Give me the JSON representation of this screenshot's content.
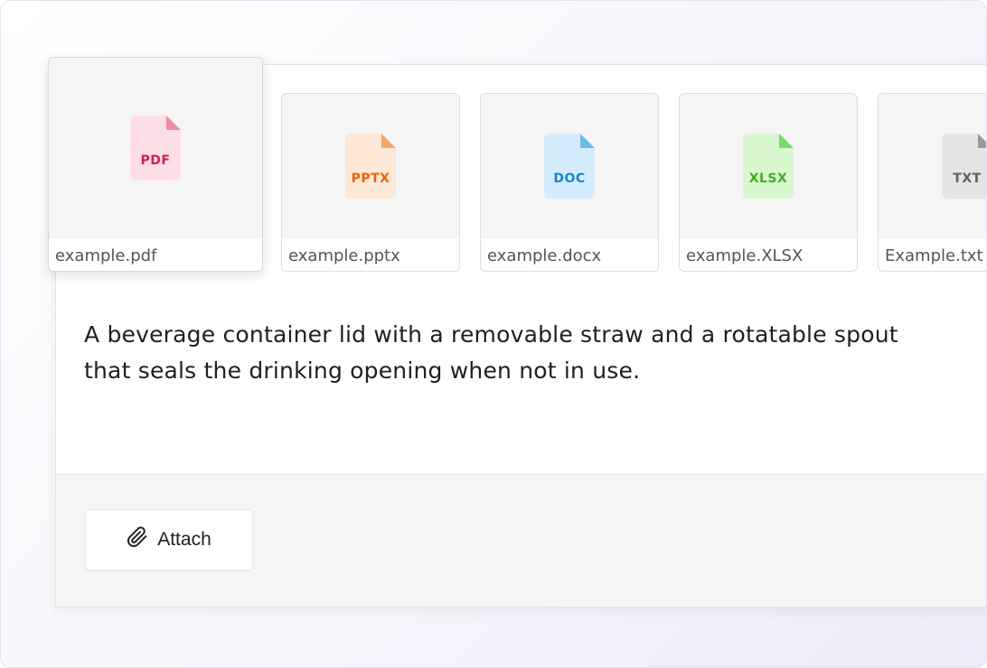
{
  "attachments": [
    {
      "type_label": "PDF",
      "filename": "example.pdf",
      "selected": true,
      "color_bg": "#fcdfe6",
      "color_fold": "#ee8ba4",
      "color_text": "#d81b50"
    },
    {
      "type_label": "PPTX",
      "filename": "example.pptx",
      "selected": false,
      "color_bg": "#fde8d6",
      "color_fold": "#f0a86b",
      "color_text": "#e8650c"
    },
    {
      "type_label": "DOC",
      "filename": "example.docx",
      "selected": false,
      "color_bg": "#d4ecfb",
      "color_fold": "#6bbbe9",
      "color_text": "#1a86cc"
    },
    {
      "type_label": "XLSX",
      "filename": "example.XLSX",
      "selected": false,
      "color_bg": "#d9f6cf",
      "color_fold": "#7fd66a",
      "color_text": "#3fae22"
    },
    {
      "type_label": "TXT",
      "filename": "Example.txt",
      "selected": false,
      "color_bg": "#e5e5e5",
      "color_fold": "#9a9a9a",
      "color_text": "#616161"
    }
  ],
  "message": {
    "text": "A beverage container lid with a removable straw and a rotatable spout that seals the drinking opening when not in use."
  },
  "footer": {
    "attach_label": "Attach",
    "attach_icon": "paperclip-icon"
  }
}
